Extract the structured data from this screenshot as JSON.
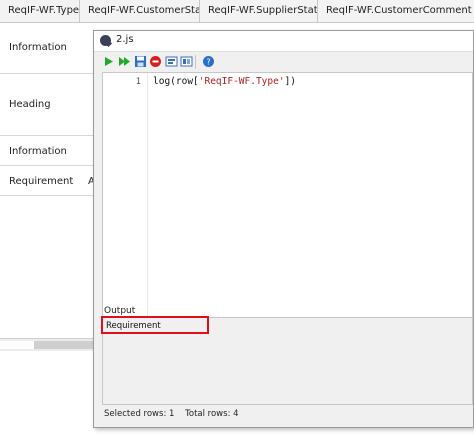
{
  "table": {
    "headers": [
      "ReqIF-WF.Type",
      "ReqIF-WF.CustomerStatus",
      "ReqIF-WF.SupplierStatus",
      "ReqIF-WF.CustomerComment"
    ],
    "rows": [
      {
        "type": "Information",
        "extra": ""
      },
      {
        "type": "Heading",
        "extra": ""
      },
      {
        "type": "Information",
        "extra": ""
      },
      {
        "type": "Requirement",
        "extra": "A"
      }
    ]
  },
  "window": {
    "title": "2.js",
    "toolbar": {
      "icons": [
        "run-icon",
        "run-all-icon",
        "save-icon",
        "stop-icon",
        "panel-icon",
        "panel-alt-icon",
        "help-icon"
      ]
    },
    "editor": {
      "line_number": "1",
      "code_prefix": "log(row[",
      "code_string": "'ReqIF-WF.Type'",
      "code_suffix": "])"
    },
    "output": {
      "label": "Output",
      "text": "Requirement"
    },
    "status": {
      "selected_rows": "Selected rows: 1",
      "total_rows": "Total rows: 4"
    }
  },
  "colors": {
    "highlight": "#e0101a",
    "run_green": "#1faa2c",
    "stop_red": "#d21f1f",
    "help_blue": "#2a6fc9"
  }
}
